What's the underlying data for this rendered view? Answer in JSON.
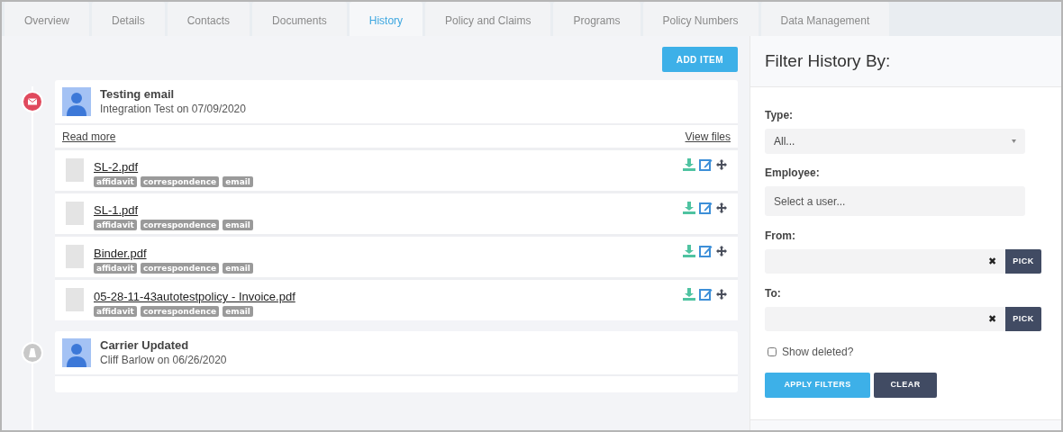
{
  "tabs": [
    {
      "label": "Overview",
      "selected": false
    },
    {
      "label": "Details",
      "selected": false
    },
    {
      "label": "Contacts",
      "selected": false
    },
    {
      "label": "Documents",
      "selected": false
    },
    {
      "label": "History",
      "selected": true
    },
    {
      "label": "Policy and Claims",
      "selected": false
    },
    {
      "label": "Programs",
      "selected": false
    },
    {
      "label": "Policy Numbers",
      "selected": false
    },
    {
      "label": "Data Management",
      "selected": false
    }
  ],
  "add_button": "ADD ITEM",
  "events": [
    {
      "kind": "email",
      "title": "Testing email",
      "byline": "Integration Test on 07/09/2020",
      "read_more": "Read more",
      "view_files": "View files",
      "files": [
        {
          "name": "SL-2.pdf",
          "tags": [
            "affidavit",
            "correspondence",
            "email"
          ]
        },
        {
          "name": "SL-1.pdf",
          "tags": [
            "affidavit",
            "correspondence",
            "email"
          ]
        },
        {
          "name": "Binder.pdf",
          "tags": [
            "affidavit",
            "correspondence",
            "email"
          ]
        },
        {
          "name": "05-28-11-43autotestpolicy - Invoice.pdf",
          "tags": [
            "affidavit",
            "correspondence",
            "email"
          ]
        }
      ]
    },
    {
      "kind": "carrier",
      "title": "Carrier Updated",
      "byline": "Cliff Barlow on 06/26/2020"
    }
  ],
  "filter": {
    "title": "Filter History By:",
    "type_label": "Type:",
    "type_value": "All...",
    "employee_label": "Employee:",
    "employee_placeholder": "Select a user...",
    "dates": [
      {
        "label": "From:",
        "clear_mark": "✖",
        "pick": "PICK"
      },
      {
        "label": "To:",
        "clear_mark": "✖",
        "pick": "PICK"
      }
    ],
    "show_deleted": {
      "label": "Show deleted?",
      "checked": false
    },
    "apply": "APPLY FILTERS",
    "clear": "CLEAR"
  }
}
